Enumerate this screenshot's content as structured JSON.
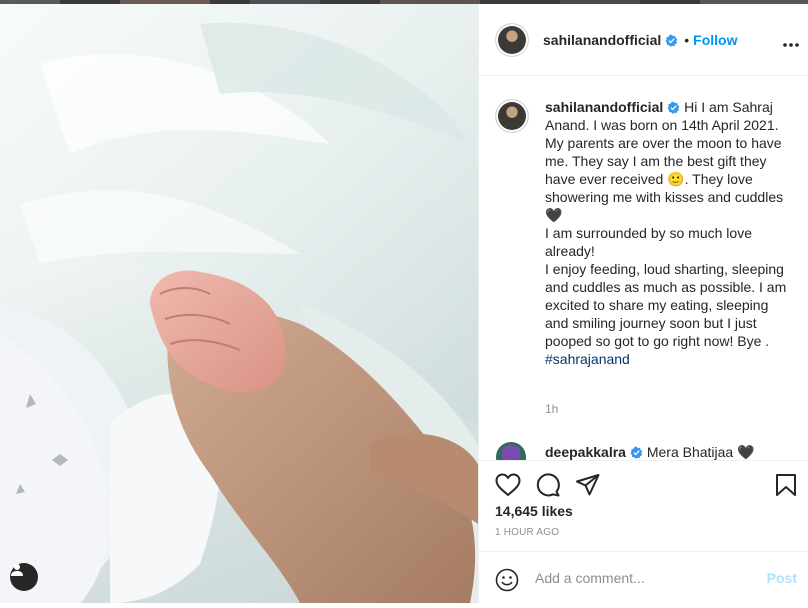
{
  "post": {
    "username": "sahilanandofficial",
    "dot": "•",
    "follow_label": "Follow",
    "caption": "Hi I am Sahraj Anand. I was born on 14th April 2021. My parents are over the moon to have me. They say I am the best gift they have ever received 🙂. They love showering me with kisses and cuddles 🖤\nI am surrounded by so much love already!\nI enjoy feeding, loud sharting, sleeping and cuddles as much as possible. I am excited to share my eating, sleeping and smiling journey soon but I just pooped so got to go right now! Bye .",
    "hashtag": "#sahrajanand",
    "caption_time": "1h",
    "likes": "14,645 likes",
    "posted_ago": "1 HOUR AGO"
  },
  "comments": [
    {
      "username": "deepakkalra",
      "text": "Mera Bhatijaa 🖤"
    }
  ],
  "add_comment": {
    "placeholder": "Add a comment...",
    "post_label": "Post"
  },
  "icons": [
    "verified-badge-icon",
    "more-options-icon",
    "heart-icon",
    "comment-icon",
    "share-icon",
    "bookmark-icon",
    "emoji-icon",
    "user-tag-icon"
  ],
  "colors": {
    "accent": "#0095f6",
    "verified": "#3897f0",
    "text": "#262626",
    "muted": "#8e8e8e",
    "hashtag": "#00376b",
    "post_disabled": "#b2dffc"
  }
}
